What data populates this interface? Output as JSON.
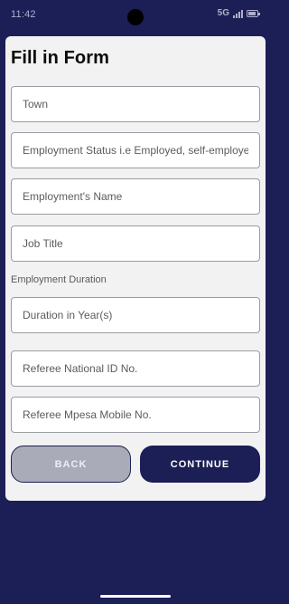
{
  "status_bar": {
    "time": "11:42",
    "network": "5G"
  },
  "form": {
    "title": "Fill in Form",
    "fields": {
      "town": {
        "placeholder": "Town",
        "value": ""
      },
      "employment_status": {
        "placeholder": "Employment Status i.e Employed, self-employed",
        "value": ""
      },
      "employer_name": {
        "placeholder": "Employment's Name",
        "value": ""
      },
      "job_title": {
        "placeholder": "Job Title",
        "value": ""
      },
      "duration": {
        "placeholder": "Duration in Year(s)",
        "value": ""
      },
      "referee_id": {
        "placeholder": "Referee National ID No.",
        "value": ""
      },
      "referee_mpesa": {
        "placeholder": "Referee Mpesa Mobile No.",
        "value": ""
      }
    },
    "section_label": "Employment Duration",
    "buttons": {
      "back": "BACK",
      "continue": "CONTINUE"
    }
  },
  "colors": {
    "background": "#1c1f55",
    "card": "#f2f2f3",
    "accent": "#1c1f55",
    "back_button": "#a9abb8"
  },
  "icons": [
    "camera-cutout",
    "signal-icon",
    "battery-icon"
  ]
}
